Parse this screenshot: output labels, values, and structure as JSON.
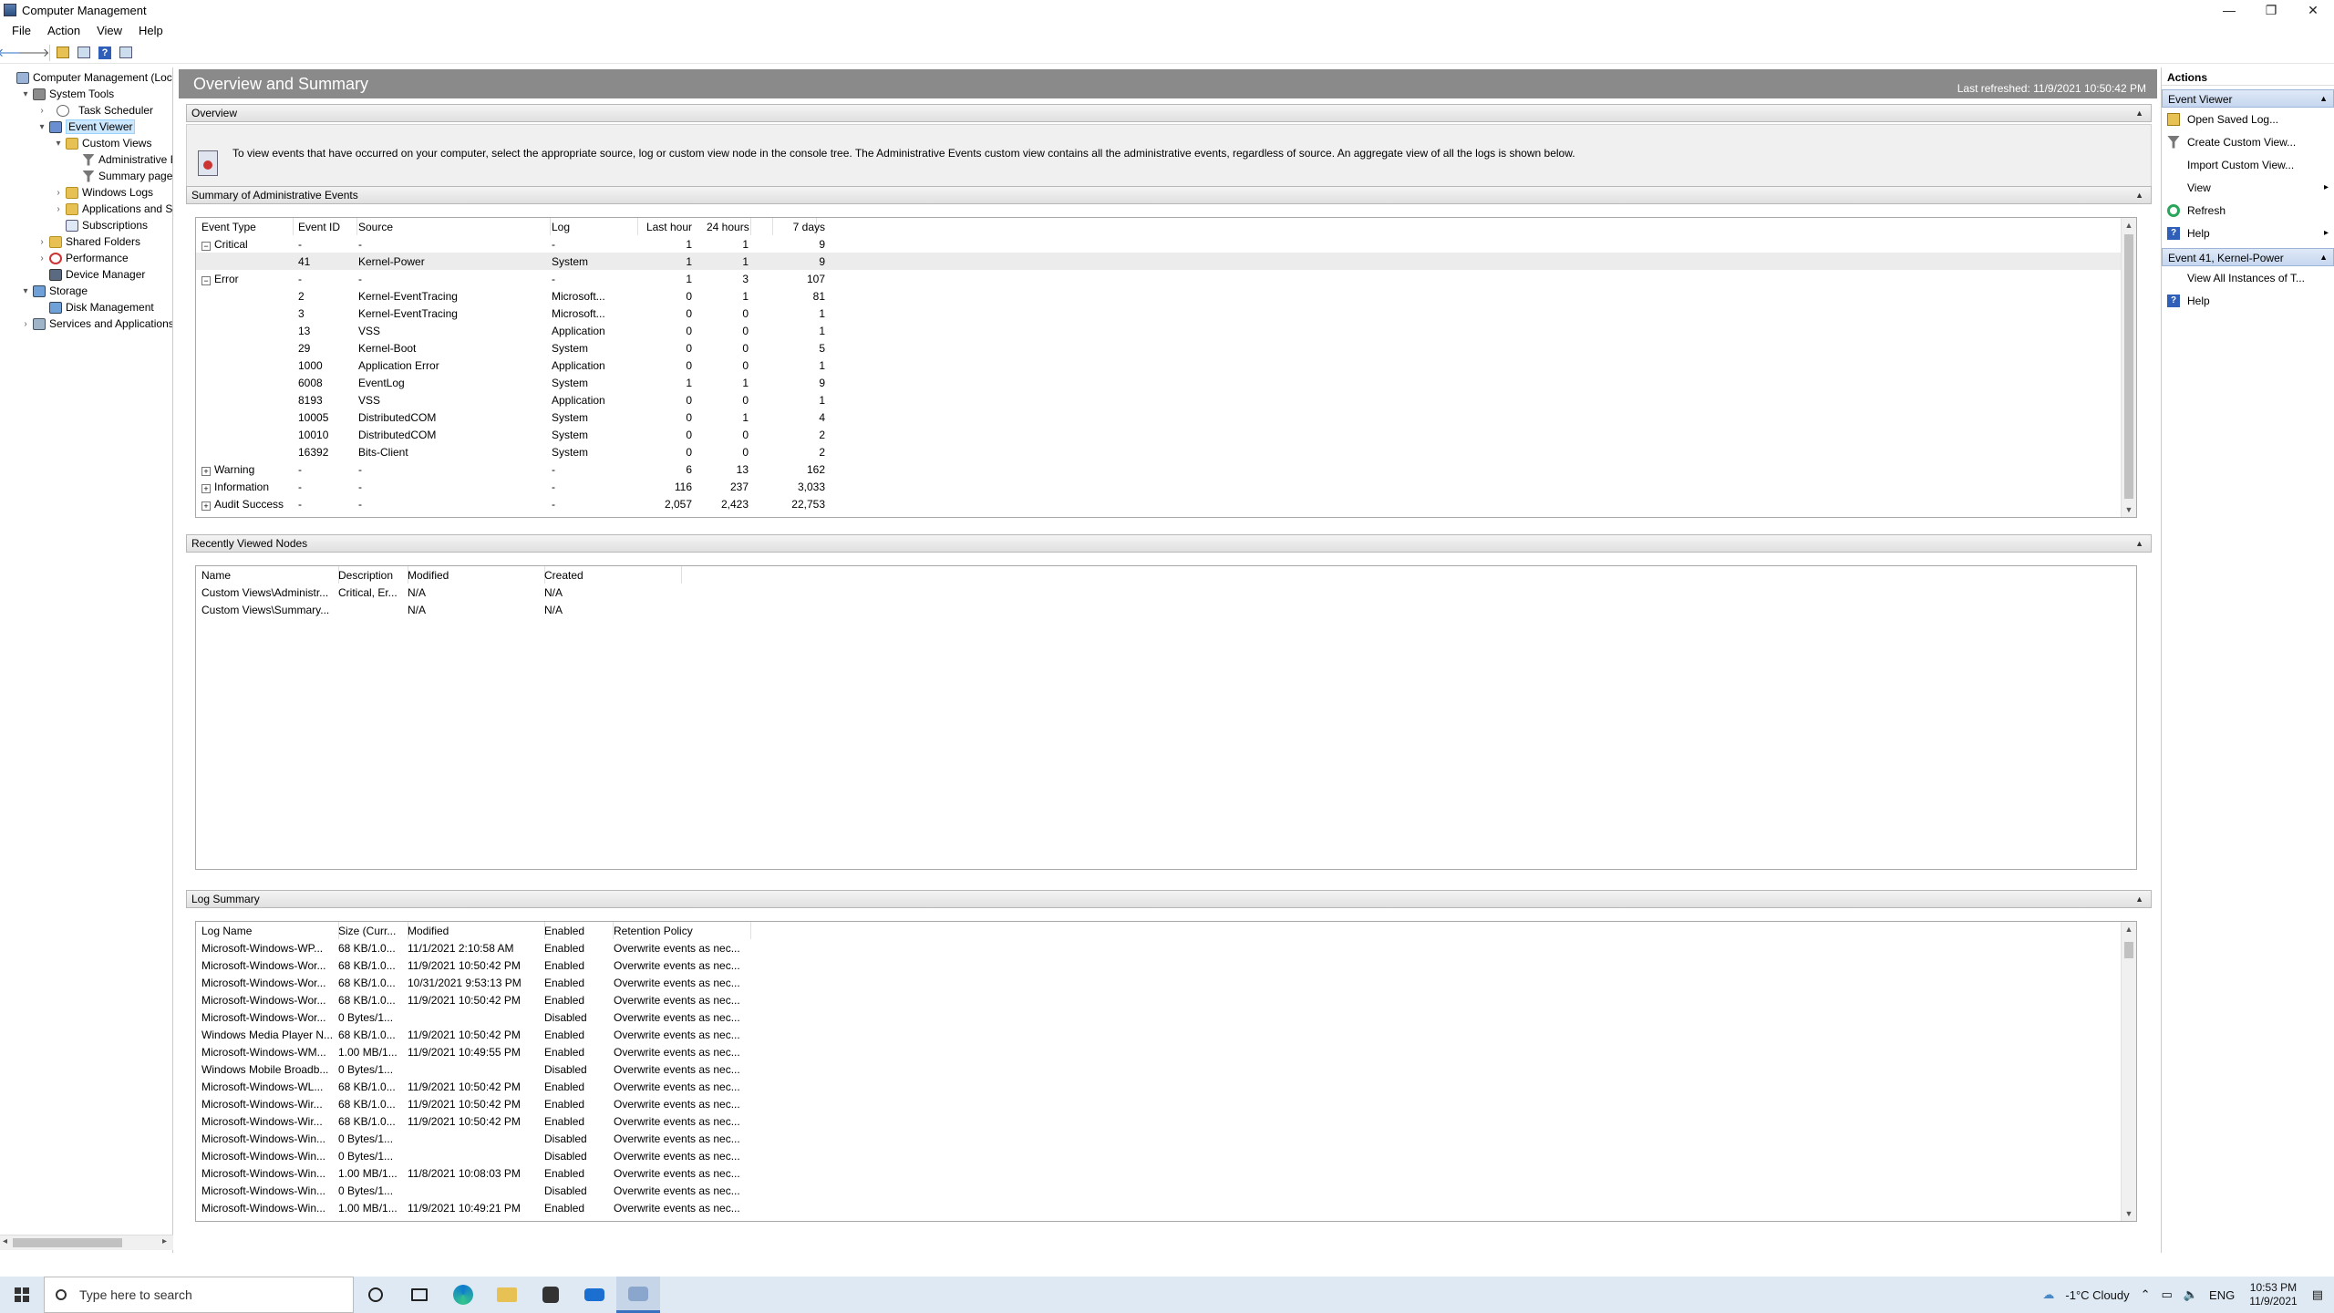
{
  "window": {
    "title": "Computer Management",
    "controls": {
      "minimize": "—",
      "restore": "❐",
      "close": "✕"
    }
  },
  "menu": [
    "File",
    "Action",
    "View",
    "Help"
  ],
  "toolbar": {
    "back": "🡐",
    "forward": "🡒",
    "help": "?"
  },
  "tree": [
    {
      "label": "Computer Management (Local",
      "indent": 0,
      "tw": "",
      "icon": "pc"
    },
    {
      "label": "System Tools",
      "indent": 1,
      "tw": "▾",
      "icon": "tools"
    },
    {
      "label": "Task Scheduler",
      "indent": 2,
      "tw": "›",
      "icon": "clock"
    },
    {
      "label": "Event Viewer",
      "indent": 2,
      "tw": "▾",
      "icon": "ev",
      "selected": true
    },
    {
      "label": "Custom Views",
      "indent": 3,
      "tw": "▾",
      "icon": "folder"
    },
    {
      "label": "Administrative E",
      "indent": 4,
      "tw": "",
      "icon": "filter"
    },
    {
      "label": "Summary page e",
      "indent": 4,
      "tw": "",
      "icon": "filter"
    },
    {
      "label": "Windows Logs",
      "indent": 3,
      "tw": "›",
      "icon": "folder"
    },
    {
      "label": "Applications and Se",
      "indent": 3,
      "tw": "›",
      "icon": "folder"
    },
    {
      "label": "Subscriptions",
      "indent": 3,
      "tw": "",
      "icon": "log"
    },
    {
      "label": "Shared Folders",
      "indent": 2,
      "tw": "›",
      "icon": "folder"
    },
    {
      "label": "Performance",
      "indent": 2,
      "tw": "›",
      "icon": "perf"
    },
    {
      "label": "Device Manager",
      "indent": 2,
      "tw": "",
      "icon": "dev"
    },
    {
      "label": "Storage",
      "indent": 1,
      "tw": "▾",
      "icon": "disk"
    },
    {
      "label": "Disk Management",
      "indent": 2,
      "tw": "",
      "icon": "disk"
    },
    {
      "label": "Services and Applications",
      "indent": 1,
      "tw": "›",
      "icon": "svc"
    }
  ],
  "header": {
    "title": "Overview and Summary",
    "refreshed": "Last refreshed: 11/9/2021 10:50:42 PM"
  },
  "overview": {
    "title": "Overview",
    "text": "To view events that have occurred on your computer, select the appropriate source, log or custom view node in the console tree. The Administrative Events custom view contains all the administrative events, regardless of source. An aggregate view of all the logs is shown below."
  },
  "summary": {
    "title": "Summary of Administrative Events",
    "columns": [
      "Event Type",
      "Event ID",
      "Source",
      "Log",
      "Last hour",
      "24 hours",
      "7 days"
    ],
    "rows": [
      {
        "type": "Critical",
        "exp": "⊟",
        "id": "-",
        "source": "-",
        "log": "-",
        "h": "1",
        "d": "1",
        "w": "9"
      },
      {
        "type": "",
        "exp": "",
        "id": "41",
        "source": "Kernel-Power",
        "log": "System",
        "h": "1",
        "d": "1",
        "w": "9",
        "hl": true
      },
      {
        "type": "Error",
        "exp": "⊟",
        "id": "-",
        "source": "-",
        "log": "-",
        "h": "1",
        "d": "3",
        "w": "107"
      },
      {
        "type": "",
        "exp": "",
        "id": "2",
        "source": "Kernel-EventTracing",
        "log": "Microsoft...",
        "h": "0",
        "d": "1",
        "w": "81"
      },
      {
        "type": "",
        "exp": "",
        "id": "3",
        "source": "Kernel-EventTracing",
        "log": "Microsoft...",
        "h": "0",
        "d": "0",
        "w": "1"
      },
      {
        "type": "",
        "exp": "",
        "id": "13",
        "source": "VSS",
        "log": "Application",
        "h": "0",
        "d": "0",
        "w": "1"
      },
      {
        "type": "",
        "exp": "",
        "id": "29",
        "source": "Kernel-Boot",
        "log": "System",
        "h": "0",
        "d": "0",
        "w": "5"
      },
      {
        "type": "",
        "exp": "",
        "id": "1000",
        "source": "Application Error",
        "log": "Application",
        "h": "0",
        "d": "0",
        "w": "1"
      },
      {
        "type": "",
        "exp": "",
        "id": "6008",
        "source": "EventLog",
        "log": "System",
        "h": "1",
        "d": "1",
        "w": "9"
      },
      {
        "type": "",
        "exp": "",
        "id": "8193",
        "source": "VSS",
        "log": "Application",
        "h": "0",
        "d": "0",
        "w": "1"
      },
      {
        "type": "",
        "exp": "",
        "id": "10005",
        "source": "DistributedCOM",
        "log": "System",
        "h": "0",
        "d": "1",
        "w": "4"
      },
      {
        "type": "",
        "exp": "",
        "id": "10010",
        "source": "DistributedCOM",
        "log": "System",
        "h": "0",
        "d": "0",
        "w": "2"
      },
      {
        "type": "",
        "exp": "",
        "id": "16392",
        "source": "Bits-Client",
        "log": "System",
        "h": "0",
        "d": "0",
        "w": "2"
      },
      {
        "type": "Warning",
        "exp": "⊞",
        "id": "-",
        "source": "-",
        "log": "-",
        "h": "6",
        "d": "13",
        "w": "162"
      },
      {
        "type": "Information",
        "exp": "⊞",
        "id": "-",
        "source": "-",
        "log": "-",
        "h": "116",
        "d": "237",
        "w": "3,033"
      },
      {
        "type": "Audit Success",
        "exp": "⊞",
        "id": "-",
        "source": "-",
        "log": "-",
        "h": "2,057",
        "d": "2,423",
        "w": "22,753"
      }
    ]
  },
  "recent": {
    "title": "Recently Viewed Nodes",
    "columns": [
      "Name",
      "Description",
      "Modified",
      "Created"
    ],
    "rows": [
      {
        "name": "Custom Views\\Administr...",
        "desc": "Critical, Er...",
        "mod": "N/A",
        "cre": "N/A"
      },
      {
        "name": "Custom Views\\Summary...",
        "desc": "",
        "mod": "N/A",
        "cre": "N/A"
      }
    ]
  },
  "logsum": {
    "title": "Log Summary",
    "columns": [
      "Log Name",
      "Size (Curr...",
      "Modified",
      "Enabled",
      "Retention Policy"
    ],
    "rows": [
      {
        "name": "Microsoft-Windows-WP...",
        "size": "68 KB/1.0...",
        "mod": "11/1/2021 2:10:58 AM",
        "en": "Enabled",
        "ret": "Overwrite events as nec..."
      },
      {
        "name": "Microsoft-Windows-Wor...",
        "size": "68 KB/1.0...",
        "mod": "11/9/2021 10:50:42 PM",
        "en": "Enabled",
        "ret": "Overwrite events as nec..."
      },
      {
        "name": "Microsoft-Windows-Wor...",
        "size": "68 KB/1.0...",
        "mod": "10/31/2021 9:53:13 PM",
        "en": "Enabled",
        "ret": "Overwrite events as nec..."
      },
      {
        "name": "Microsoft-Windows-Wor...",
        "size": "68 KB/1.0...",
        "mod": "11/9/2021 10:50:42 PM",
        "en": "Enabled",
        "ret": "Overwrite events as nec..."
      },
      {
        "name": "Microsoft-Windows-Wor...",
        "size": "0 Bytes/1...",
        "mod": "",
        "en": "Disabled",
        "ret": "Overwrite events as nec..."
      },
      {
        "name": "Windows Media Player N...",
        "size": "68 KB/1.0...",
        "mod": "11/9/2021 10:50:42 PM",
        "en": "Enabled",
        "ret": "Overwrite events as nec..."
      },
      {
        "name": "Microsoft-Windows-WM...",
        "size": "1.00 MB/1...",
        "mod": "11/9/2021 10:49:55 PM",
        "en": "Enabled",
        "ret": "Overwrite events as nec..."
      },
      {
        "name": "Windows Mobile Broadb...",
        "size": "0 Bytes/1...",
        "mod": "",
        "en": "Disabled",
        "ret": "Overwrite events as nec..."
      },
      {
        "name": "Microsoft-Windows-WL...",
        "size": "68 KB/1.0...",
        "mod": "11/9/2021 10:50:42 PM",
        "en": "Enabled",
        "ret": "Overwrite events as nec..."
      },
      {
        "name": "Microsoft-Windows-Wir...",
        "size": "68 KB/1.0...",
        "mod": "11/9/2021 10:50:42 PM",
        "en": "Enabled",
        "ret": "Overwrite events as nec..."
      },
      {
        "name": "Microsoft-Windows-Wir...",
        "size": "68 KB/1.0...",
        "mod": "11/9/2021 10:50:42 PM",
        "en": "Enabled",
        "ret": "Overwrite events as nec..."
      },
      {
        "name": "Microsoft-Windows-Win...",
        "size": "0 Bytes/1...",
        "mod": "",
        "en": "Disabled",
        "ret": "Overwrite events as nec..."
      },
      {
        "name": "Microsoft-Windows-Win...",
        "size": "0 Bytes/1...",
        "mod": "",
        "en": "Disabled",
        "ret": "Overwrite events as nec..."
      },
      {
        "name": "Microsoft-Windows-Win...",
        "size": "1.00 MB/1...",
        "mod": "11/8/2021 10:08:03 PM",
        "en": "Enabled",
        "ret": "Overwrite events as nec..."
      },
      {
        "name": "Microsoft-Windows-Win...",
        "size": "0 Bytes/1...",
        "mod": "",
        "en": "Disabled",
        "ret": "Overwrite events as nec..."
      },
      {
        "name": "Microsoft-Windows-Win...",
        "size": "1.00 MB/1...",
        "mod": "11/9/2021 10:49:21 PM",
        "en": "Enabled",
        "ret": "Overwrite events as nec..."
      }
    ]
  },
  "actions": {
    "title": "Actions",
    "groups": [
      {
        "title": "Event Viewer",
        "items": [
          {
            "label": "Open Saved Log...",
            "icon": "open"
          },
          {
            "label": "Create Custom View...",
            "icon": "filt"
          },
          {
            "label": "Import Custom View...",
            "icon": "none"
          },
          {
            "label": "View",
            "icon": "none",
            "sub": "▸"
          },
          {
            "label": "Refresh",
            "icon": "refresh"
          },
          {
            "label": "Help",
            "icon": "help",
            "sub": "▸"
          }
        ]
      },
      {
        "title": "Event 41, Kernel-Power",
        "items": [
          {
            "label": "View All Instances of T...",
            "icon": "none"
          },
          {
            "label": "Help",
            "icon": "help"
          }
        ]
      }
    ]
  },
  "taskbar": {
    "search_placeholder": "Type here to search",
    "weather": "-1°C  Cloudy",
    "lang": "ENG",
    "time": "10:53 PM",
    "date": "11/9/2021"
  }
}
